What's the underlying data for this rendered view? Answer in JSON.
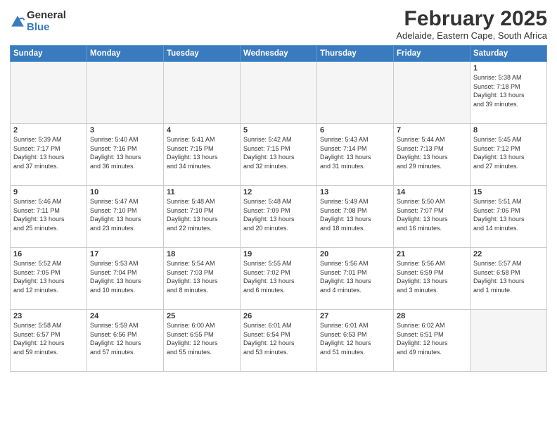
{
  "logo": {
    "general": "General",
    "blue": "Blue"
  },
  "title": "February 2025",
  "subtitle": "Adelaide, Eastern Cape, South Africa",
  "headers": [
    "Sunday",
    "Monday",
    "Tuesday",
    "Wednesday",
    "Thursday",
    "Friday",
    "Saturday"
  ],
  "weeks": [
    [
      {
        "num": "",
        "info": ""
      },
      {
        "num": "",
        "info": ""
      },
      {
        "num": "",
        "info": ""
      },
      {
        "num": "",
        "info": ""
      },
      {
        "num": "",
        "info": ""
      },
      {
        "num": "",
        "info": ""
      },
      {
        "num": "1",
        "info": "Sunrise: 5:38 AM\nSunset: 7:18 PM\nDaylight: 13 hours\nand 39 minutes."
      }
    ],
    [
      {
        "num": "2",
        "info": "Sunrise: 5:39 AM\nSunset: 7:17 PM\nDaylight: 13 hours\nand 37 minutes."
      },
      {
        "num": "3",
        "info": "Sunrise: 5:40 AM\nSunset: 7:16 PM\nDaylight: 13 hours\nand 36 minutes."
      },
      {
        "num": "4",
        "info": "Sunrise: 5:41 AM\nSunset: 7:15 PM\nDaylight: 13 hours\nand 34 minutes."
      },
      {
        "num": "5",
        "info": "Sunrise: 5:42 AM\nSunset: 7:15 PM\nDaylight: 13 hours\nand 32 minutes."
      },
      {
        "num": "6",
        "info": "Sunrise: 5:43 AM\nSunset: 7:14 PM\nDaylight: 13 hours\nand 31 minutes."
      },
      {
        "num": "7",
        "info": "Sunrise: 5:44 AM\nSunset: 7:13 PM\nDaylight: 13 hours\nand 29 minutes."
      },
      {
        "num": "8",
        "info": "Sunrise: 5:45 AM\nSunset: 7:12 PM\nDaylight: 13 hours\nand 27 minutes."
      }
    ],
    [
      {
        "num": "9",
        "info": "Sunrise: 5:46 AM\nSunset: 7:11 PM\nDaylight: 13 hours\nand 25 minutes."
      },
      {
        "num": "10",
        "info": "Sunrise: 5:47 AM\nSunset: 7:10 PM\nDaylight: 13 hours\nand 23 minutes."
      },
      {
        "num": "11",
        "info": "Sunrise: 5:48 AM\nSunset: 7:10 PM\nDaylight: 13 hours\nand 22 minutes."
      },
      {
        "num": "12",
        "info": "Sunrise: 5:48 AM\nSunset: 7:09 PM\nDaylight: 13 hours\nand 20 minutes."
      },
      {
        "num": "13",
        "info": "Sunrise: 5:49 AM\nSunset: 7:08 PM\nDaylight: 13 hours\nand 18 minutes."
      },
      {
        "num": "14",
        "info": "Sunrise: 5:50 AM\nSunset: 7:07 PM\nDaylight: 13 hours\nand 16 minutes."
      },
      {
        "num": "15",
        "info": "Sunrise: 5:51 AM\nSunset: 7:06 PM\nDaylight: 13 hours\nand 14 minutes."
      }
    ],
    [
      {
        "num": "16",
        "info": "Sunrise: 5:52 AM\nSunset: 7:05 PM\nDaylight: 13 hours\nand 12 minutes."
      },
      {
        "num": "17",
        "info": "Sunrise: 5:53 AM\nSunset: 7:04 PM\nDaylight: 13 hours\nand 10 minutes."
      },
      {
        "num": "18",
        "info": "Sunrise: 5:54 AM\nSunset: 7:03 PM\nDaylight: 13 hours\nand 8 minutes."
      },
      {
        "num": "19",
        "info": "Sunrise: 5:55 AM\nSunset: 7:02 PM\nDaylight: 13 hours\nand 6 minutes."
      },
      {
        "num": "20",
        "info": "Sunrise: 5:56 AM\nSunset: 7:01 PM\nDaylight: 13 hours\nand 4 minutes."
      },
      {
        "num": "21",
        "info": "Sunrise: 5:56 AM\nSunset: 6:59 PM\nDaylight: 13 hours\nand 3 minutes."
      },
      {
        "num": "22",
        "info": "Sunrise: 5:57 AM\nSunset: 6:58 PM\nDaylight: 13 hours\nand 1 minute."
      }
    ],
    [
      {
        "num": "23",
        "info": "Sunrise: 5:58 AM\nSunset: 6:57 PM\nDaylight: 12 hours\nand 59 minutes."
      },
      {
        "num": "24",
        "info": "Sunrise: 5:59 AM\nSunset: 6:56 PM\nDaylight: 12 hours\nand 57 minutes."
      },
      {
        "num": "25",
        "info": "Sunrise: 6:00 AM\nSunset: 6:55 PM\nDaylight: 12 hours\nand 55 minutes."
      },
      {
        "num": "26",
        "info": "Sunrise: 6:01 AM\nSunset: 6:54 PM\nDaylight: 12 hours\nand 53 minutes."
      },
      {
        "num": "27",
        "info": "Sunrise: 6:01 AM\nSunset: 6:53 PM\nDaylight: 12 hours\nand 51 minutes."
      },
      {
        "num": "28",
        "info": "Sunrise: 6:02 AM\nSunset: 6:51 PM\nDaylight: 12 hours\nand 49 minutes."
      },
      {
        "num": "",
        "info": ""
      }
    ]
  ]
}
